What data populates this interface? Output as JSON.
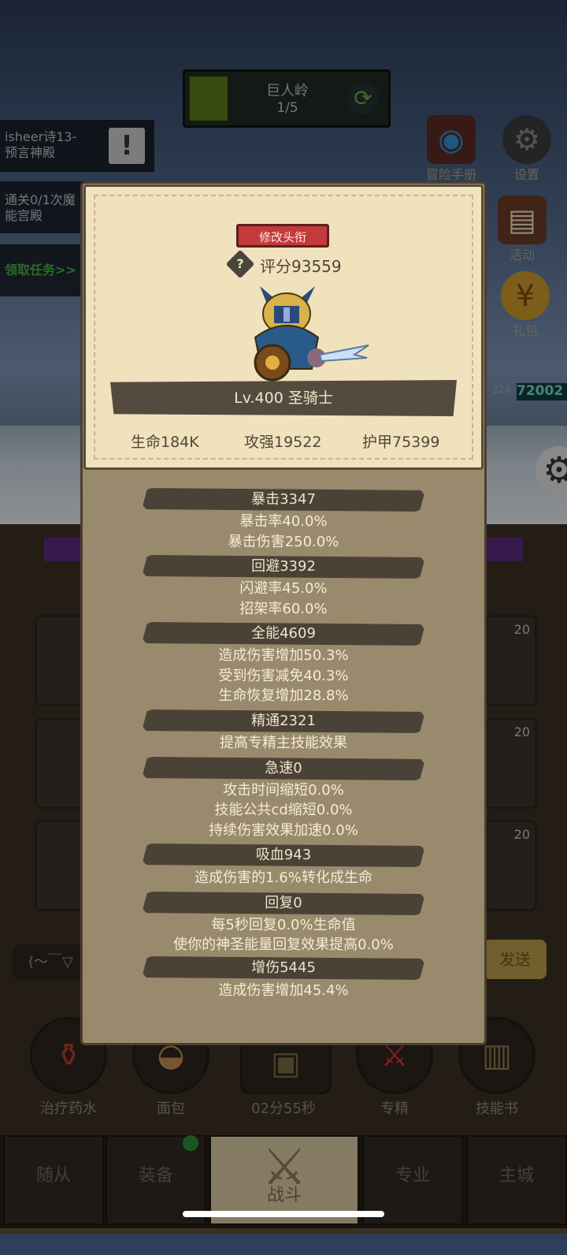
{
  "stage": {
    "name": "巨人岭",
    "progress": "1/5"
  },
  "quests": {
    "quest1": "isheer诗13-\n预言神殿",
    "quest2": "通关0/1次魔\n能宫殿",
    "claim": "领取任务>>"
  },
  "right_menu": {
    "handbook": "冒险手册",
    "settings": "设置",
    "activity": "活动",
    "gift": "礼包"
  },
  "enemy": {
    "level": "324",
    "hp": "72002"
  },
  "tiles": {
    "count1": "20",
    "count2": "20",
    "count3": "20"
  },
  "chat_input": "(～￣▽",
  "send_button": "发送",
  "bottom_actions": {
    "potion": "治疗药水",
    "bread": "面包",
    "timer": "02分55秒",
    "mastery": "专精",
    "skillbook": "技能书"
  },
  "tabs": {
    "followers": "随从",
    "equipment": "装备",
    "battle": "战斗",
    "profession": "专业",
    "city": "主城"
  },
  "dialog": {
    "change_title": "修改头衔",
    "score": "评分93559",
    "level_class": "Lv.400 圣骑士",
    "hp": "生命184K",
    "attack": "攻强19522",
    "armor": "护甲75399",
    "crit": "暴击3347",
    "crit_rate": "暴击率40.0%",
    "crit_damage": "暴击伤害250.0%",
    "dodge": "回避3392",
    "dodge_rate": "闪避率45.0%",
    "parry_rate": "招架率60.0%",
    "versatility": "全能4609",
    "vers_dmg": "造成伤害增加50.3%",
    "vers_reduce": "受到伤害减免40.3%",
    "vers_heal": "生命恢复增加28.8%",
    "mastery": "精通2321",
    "mastery_desc": "提高专精主技能效果",
    "haste": "急速0",
    "haste_attack": "攻击时间缩短0.0%",
    "haste_cd": "技能公共cd缩短0.0%",
    "haste_dot": "持续伤害效果加速0.0%",
    "leech": "吸血943",
    "leech_desc": "造成伤害的1.6%转化成生命",
    "regen": "回复0",
    "regen_hp": "每5秒回复0.0%生命值",
    "regen_power": "使你的神圣能量回复效果提高0.0%",
    "dmg_boost": "增伤5445",
    "dmg_boost_desc": "造成伤害增加45.4%"
  }
}
